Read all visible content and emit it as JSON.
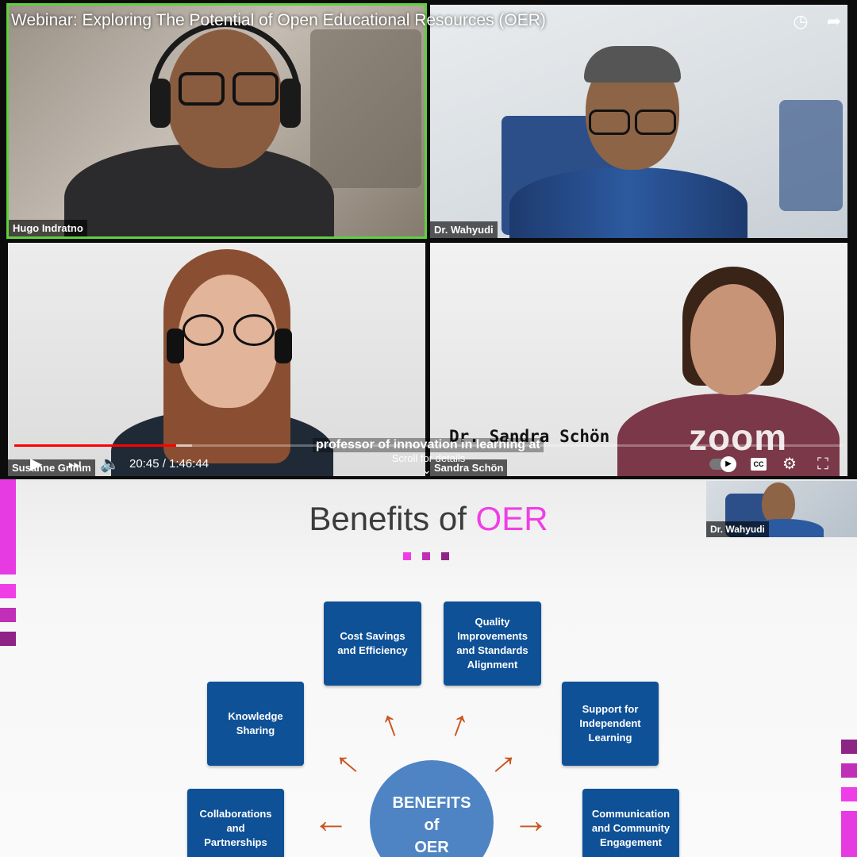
{
  "video": {
    "title": "Webinar: Exploring The Potential of Open Educational Resources (OER)",
    "icons": [
      "clock-icon",
      "share-icon"
    ],
    "participants": [
      {
        "name": "Hugo Indratno",
        "active_speaker": true
      },
      {
        "name": "Dr. Wahyudi",
        "active_speaker": false
      },
      {
        "name": "Susanne Grimm",
        "active_speaker": false
      },
      {
        "name": "Sandra Schön",
        "active_speaker": false
      }
    ],
    "caption": "professor of innovation in learning at",
    "speaker_overlay": "Dr. Sandra Schön",
    "zoom_logo": "zoom",
    "scroll_hint": "Scroll for details",
    "time_display": "20:45 / 1:46:44",
    "progress_played": 0.195,
    "progress_loaded": 0.215,
    "accent_color": "#ff0000",
    "active_border_color": "#5ed13c"
  },
  "slide": {
    "title_prefix": "Benefits of ",
    "title_accent": "OER",
    "accent_color": "#f03ee6",
    "pip_name": "Dr. Wahyudi",
    "hub_label_lines": [
      "BENEFITS",
      "of",
      "OER"
    ],
    "boxes": [
      {
        "label": "Cost Savings and Efficiency"
      },
      {
        "label": "Quality Improvements and Standards Alignment"
      },
      {
        "label": "Knowledge Sharing"
      },
      {
        "label": "Support for Independent Learning"
      },
      {
        "label": "Collaborations and Partnerships"
      },
      {
        "label": "Communication and Community Engagement"
      }
    ],
    "box_color": "#0f5197",
    "arrow_color": "#c9561e"
  }
}
